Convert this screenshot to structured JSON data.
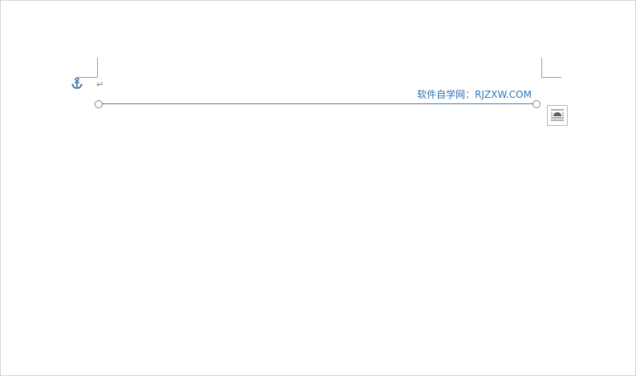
{
  "document": {
    "paragraph_mark": "↵",
    "watermark_text": "软件自学网：RJZXW.COM"
  },
  "icons": {
    "anchor": "anchor-icon",
    "layout_options": "layout-options-icon"
  },
  "colors": {
    "line": "#4a76a8",
    "watermark": "#2e75b6",
    "anchor": "#4a76a8"
  }
}
